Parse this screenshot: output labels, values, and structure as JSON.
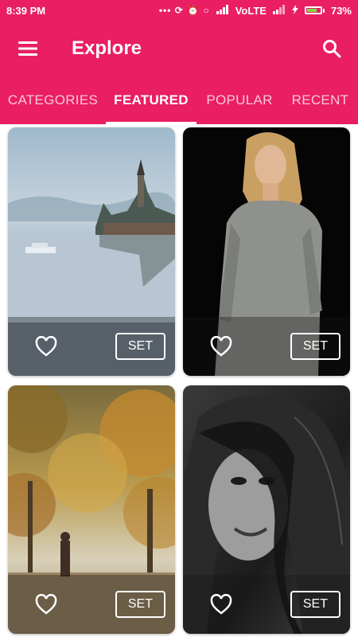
{
  "status": {
    "time": "8:39 PM",
    "icons": "••• ⟳ ⏰ ○",
    "network": "VoLTE",
    "battery": "73%",
    "battery_level": 0.73,
    "battery_color": "#7cdc43"
  },
  "toolbar": {
    "title": "Explore",
    "menu_icon": "hamburger-menu-icon",
    "search_icon": "search-icon"
  },
  "tabs": [
    {
      "label": "CATEGORIES",
      "active": false
    },
    {
      "label": "FEATURED",
      "active": true
    },
    {
      "label": "POPULAR",
      "active": false
    },
    {
      "label": "RECENT",
      "active": false
    }
  ],
  "cards": [
    {
      "set_label": "SET",
      "favorite_icon": "heart-outline-icon"
    },
    {
      "set_label": "SET",
      "favorite_icon": "heart-outline-icon"
    },
    {
      "set_label": "SET",
      "favorite_icon": "heart-outline-icon"
    },
    {
      "set_label": "SET",
      "favorite_icon": "heart-outline-icon"
    }
  ],
  "colors": {
    "primary": "#e91e63",
    "text_on_primary": "#ffffff",
    "inactive_tab": "rgba(255,255,255,0.75)"
  }
}
